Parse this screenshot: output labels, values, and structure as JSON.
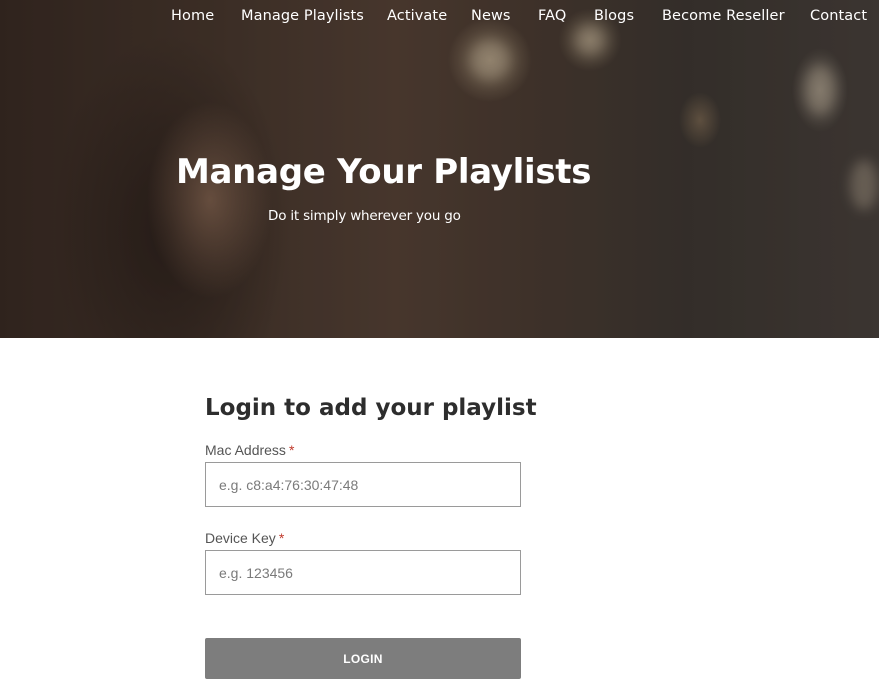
{
  "nav": {
    "items": [
      {
        "label": "Home"
      },
      {
        "label": "Manage Playlists"
      },
      {
        "label": "Activate"
      },
      {
        "label": "News"
      },
      {
        "label": "FAQ"
      },
      {
        "label": "Blogs"
      },
      {
        "label": "Become Reseller"
      },
      {
        "label": "Contact"
      }
    ]
  },
  "hero": {
    "title": "Manage Your Playlists",
    "subtitle": "Do it simply wherever you go"
  },
  "login_form": {
    "title": "Login to add your playlist",
    "mac_address": {
      "label": "Mac Address",
      "required_mark": "*",
      "placeholder": "e.g. c8:a4:76:30:47:48",
      "value": ""
    },
    "device_key": {
      "label": "Device Key",
      "required_mark": "*",
      "placeholder": "e.g. 123456",
      "value": ""
    },
    "submit_label": "LOGIN"
  },
  "colors": {
    "button_bg": "#7d7d7d",
    "required_star": "#c0392b",
    "heading_text": "#2d2d2d",
    "label_text": "#555555"
  }
}
